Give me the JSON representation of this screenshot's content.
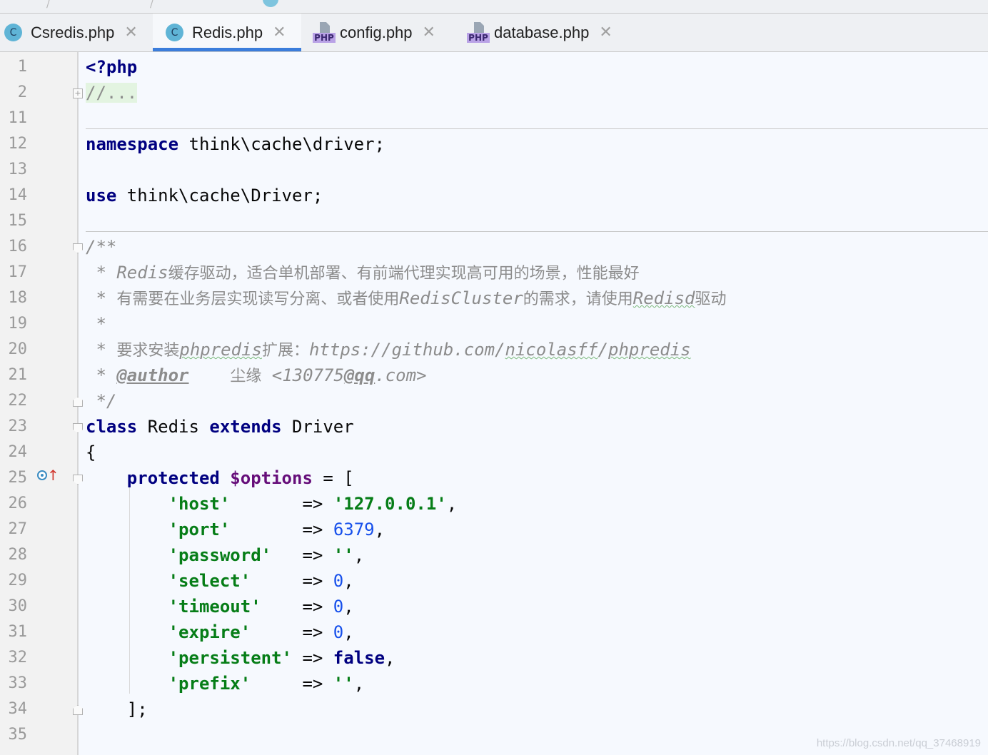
{
  "tabs": [
    {
      "icon": "class-icon",
      "icon_text": "C",
      "label": "Csredis.php",
      "active": false
    },
    {
      "icon": "class-icon",
      "icon_text": "C",
      "label": "Redis.php",
      "active": true
    },
    {
      "icon": "php-file-icon",
      "icon_text": "PHP",
      "label": "config.php",
      "active": false
    },
    {
      "icon": "php-file-icon",
      "icon_text": "PHP",
      "label": "database.php",
      "active": false
    }
  ],
  "close_glyph": "✕",
  "line_numbers": [
    "1",
    "2",
    "11",
    "12",
    "13",
    "14",
    "15",
    "16",
    "17",
    "18",
    "19",
    "20",
    "21",
    "22",
    "23",
    "24",
    "25",
    "26",
    "27",
    "28",
    "29",
    "30",
    "31",
    "32",
    "33",
    "34",
    "35"
  ],
  "code": {
    "l1": {
      "open": "<?php"
    },
    "l2": {
      "folded": "//..."
    },
    "l12": {
      "kw": "namespace",
      "rest": " think\\cache\\driver;"
    },
    "l14": {
      "kw": "use",
      "rest": " think\\cache\\Driver;"
    },
    "l16": {
      "text": "/**"
    },
    "l17": {
      "star": " * ",
      "name": "Redis",
      "desc": "缓存驱动，适合单机部署、有前端代理实现高可用的场景，性能最好"
    },
    "l18": {
      "star": " * ",
      "desc1": "有需要在业务层实现读写分离、或者使用",
      "name": "RedisCluster",
      "desc2": "的需求，请使用",
      "name2": "Redisd",
      "desc3": "驱动"
    },
    "l19": {
      "text": " *"
    },
    "l20": {
      "star": " * ",
      "desc1": "要求安装",
      "ext": "phpredis",
      "desc2": "扩展：",
      "url1": "https://github.com/",
      "url2": "nicolasff",
      "url3": "/",
      "url4": "phpredis"
    },
    "l21": {
      "star": " * ",
      "tag": "@author",
      "gap": "    ",
      "author": "尘缘",
      "email1": " <130775",
      "email2": "@qq",
      "email3": ".com>"
    },
    "l22": {
      "text": " */"
    },
    "l23": {
      "kw1": "class",
      "name": " Redis ",
      "kw2": "extends",
      "parent": " Driver"
    },
    "l24": {
      "text": "{"
    },
    "l25": {
      "indent": "    ",
      "kw": "protected",
      "sp": " ",
      "var": "$options",
      "rest": " = ["
    },
    "options": [
      {
        "key": "'host'",
        "pad": "       ",
        "arrow": "=> ",
        "val": "'127.0.0.1'",
        "type": "str"
      },
      {
        "key": "'port'",
        "pad": "       ",
        "arrow": "=> ",
        "val": "6379",
        "type": "num"
      },
      {
        "key": "'password'",
        "pad": "   ",
        "arrow": "=> ",
        "val": "''",
        "type": "str"
      },
      {
        "key": "'select'",
        "pad": "     ",
        "arrow": "=> ",
        "val": "0",
        "type": "num"
      },
      {
        "key": "'timeout'",
        "pad": "    ",
        "arrow": "=> ",
        "val": "0",
        "type": "num"
      },
      {
        "key": "'expire'",
        "pad": "     ",
        "arrow": "=> ",
        "val": "0",
        "type": "num"
      },
      {
        "key": "'persistent'",
        "pad": " ",
        "arrow": "=> ",
        "val": "false",
        "type": "kw"
      },
      {
        "key": "'prefix'",
        "pad": "     ",
        "arrow": "=> ",
        "val": "''",
        "type": "str"
      }
    ],
    "comma": ",",
    "l34": {
      "text": "    ];"
    }
  },
  "watermark": "https://blog.csdn.net/qq_37468919"
}
